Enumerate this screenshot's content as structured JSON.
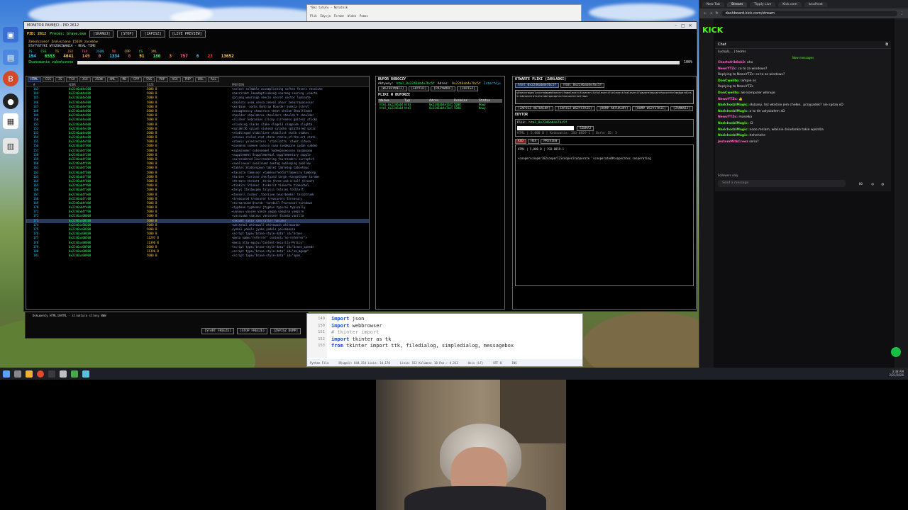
{
  "notepad": {
    "title": "*Bez tytułu - Notatnik",
    "menu": [
      "Plik",
      "Edycja",
      "Format",
      "Widok",
      "Pomoc"
    ]
  },
  "app": {
    "title": "MONITOR PAMIĘCI - PID 2612",
    "pid_label": "PID: 2612",
    "process_label": "Proces: brave.exe",
    "buttons": [
      "[SKANUJ]",
      "[STOP]",
      "[ZAPISZ]",
      "[LIVE PREVIEW]"
    ],
    "line_finished": "Zakończono! Znaleziono 15619 zasobów",
    "line_stats": "STATYSTYKI WYSZUKIWANIA - REAL-TIME",
    "stat_labels": [
      "JS",
      "CSS",
      "TS",
      "JSX",
      "TSX",
      "JSON",
      "MD",
      "CPP",
      "CS",
      "XML"
    ],
    "stat_values": [
      "194",
      "6553",
      "4041",
      "149",
      "0",
      "1334",
      "0",
      "91",
      "180",
      "3",
      "757",
      "6",
      "23",
      "13652"
    ],
    "scan_status": "Skanowanie zakończone",
    "progress_pct": "100%",
    "progress_value": 1.0,
    "grid_tabs": [
      "HTML",
      "CSS",
      "JS",
      "TSX",
      "JSX",
      "JSON",
      "XML",
      "MD",
      "CPP",
      "SVG",
      "PHP",
      "ASX",
      "PHP",
      "URL",
      "ALL"
    ],
    "grid_headers": [
      "#",
      "ADDR",
      "SIZE",
      "PREVIEW"
    ],
    "grid_rows": [
      [
        "143",
        "0x2246ab4e308",
        "5000 B",
        "<select seldable accomplishing soften fevers resolute"
      ],
      [
        "144",
        "0x2246ab4e408",
        "5000 B",
        "coacritakt lawadaptiveknog soarneg searing ,coacte"
      ],
      [
        "145",
        "0x2246ab4e508",
        "5000 B",
        "cprjong wearingo seecin secret sector luminate"
      ],
      [
        "146",
        "0x2246ab4e608",
        "5000 B",
        "<zealots usea sensa zeneal ansor zeearrapacessor"
      ],
      [
        "147",
        "0x2246ab4e708",
        "5000 B",
        "<xorbian -xorbs Rontrax Roarder zonkta schrot"
      ],
      [
        "148",
        "0x2246ab4e808",
        "5000 B",
        "schaughnessy shawcross sheat sholan Shoultleach"
      ],
      [
        "149",
        "0x2246ab4e908",
        "5000 B",
        "shoulder shoulderes shoulders shouldn't shoulder"
      ],
      [
        "150",
        "0x2246ab4ea08",
        "5000 B",
        "<slicker Sobranies slicky sirreness gaitess sticks"
      ],
      [
        "151",
        "0x2246ab4eb08",
        "5000 B",
        "<slacking slacks slake slagel3 slagelde slighte"
      ],
      [
        "152",
        "0x2246ab4ec08",
        "5000 B",
        "<splakl16 splash sixkes8 splashe splattered splic"
      ],
      [
        "153",
        "0x2246ab4ed08",
        "5000 B",
        "<stablinged stabilizer stabilist stalk stakes"
      ],
      [
        "154",
        "0x2246ab4ee08",
        "5000 B",
        "<stasun staled stat state static-of-the-art stati"
      ],
      [
        "155",
        "0x2246ab4ef08",
        "5000 B",
        "<stwels yuleszerters 'stzellotts 'stwer,sitwsa"
      ],
      [
        "156",
        "0x2246ab4f008",
        "5000 B",
        "<cueanno sueeee suesso suaa sueakpine sudan sudden"
      ],
      [
        "157",
        "0x2246ab4f108",
        "5000 B",
        "<subsonomer subsonemel Sudeepnoeessex suoaaoaaa"
      ],
      [
        "158",
        "0x2246ab4f208",
        "5000 B",
        "<supplement Ssupplemental supplementary supple"
      ],
      [
        "159",
        "0x2246ab4f308",
        "5000 B",
        "<surrendered Isurrendering fsurrenders surreptit"
      ],
      [
        "160",
        "0x2246ab4f408",
        "5000 B",
        "<swallouua? swalloued swetag swaloqing swallow"
      ],
      [
        "161",
        "0x2246ab4f508",
        "5000 B",
        "<tables Stablespoon tablet tabletop tabletops"
      ],
      [
        "162",
        "0x2246ab4f608",
        "5000 B",
        "<tacoste tamesnor +tamenorfeotor!Tamencry tamblep"
      ],
      [
        "163",
        "0x2246ab4f708",
        "5000 B",
        "<tarine -tarinse cherlyaid targe +targethame tarame"
      ],
      [
        "164",
        "0x2246ab4f808",
        "5000 B",
        "<threats threatt ,three three-and-a-half threatt"
      ],
      [
        "165",
        "0x2246ab4f908",
        "5000 B",
        "<tinkits Stinker ,tinkerit tinkorte tinkorbel"
      ],
      [
        "166",
        "0x2246ab4fa08",
        "5000 B",
        "<tolyl Itolbyspeo tolylsi tolnies tolblert"
      ],
      [
        "167",
        "0x2246ab4fb08",
        "5000 B",
        "<toesnll tucker ,tocsiiee toucrbookir tosibtrunk"
      ],
      [
        "168",
        "0x2246ab4fc08",
        "5000 B",
        "<treasured treasurer treasurers Streasury"
      ],
      [
        "169",
        "0x2246ab4fd08",
        "5000 B",
        "<turnaround Qturnb 'turnbull Fturncoat turndown"
      ],
      [
        "170",
        "0x2246ab4fe08",
        "5000 B",
        "<typhoon typhoons jtyphus typical typically"
      ],
      [
        "171",
        "0x2246ab4ff08",
        "5000 B",
        "<uuuuuu vaucee vance vagaa vangina vampire"
      ],
      [
        "172",
        "0x2246ac00008",
        "5000 B",
        "<vascuuma vaacous vancouver Evanda vanilla"
      ],
      [
        "173",
        "0x2246ac00108",
        "5000 B",
        "<neaumt sanie sancratier hacuker",
        "sel"
      ],
      [
        "174",
        "0x2246ac00208",
        "5000 B",
        "<whitewal whitewall whitewash whitewater"
      ],
      [
        "175",
        "0x2246ac00308",
        "5000 B",
        "<yokel yokels jyoke yodels yolooaassa"
      ],
      [
        "176",
        "0x2246ac00408",
        "5000 B",
        "<script type=\"brave-style-data\" id=\"brave"
      ],
      [
        "177",
        "0x2246ac00508",
        "11297 B",
        "<meta name=\"referrer\" content=\"no-referrer\">"
      ],
      [
        "178",
        "0x2246ac00608",
        "11396 B",
        "<meta http-equiv=\"Content-Security-Policy\""
      ],
      [
        "179",
        "0x2246ac00708",
        "5000 B",
        "<script type=\"brave-style-data\" id=\"brave_speedr"
      ],
      [
        "180",
        "0x2246ac00808",
        "11396 B",
        "<script type=\"brave-style-data\" id=\"aa_mgsqm\""
      ],
      [
        "181",
        "0x2246ac00908",
        "5000 B",
        "<script type=\"brave-style-data\" id=\"open_"
      ]
    ],
    "buffer": {
      "title": "BUFOR ROBOCZY",
      "active_label": "Aktywny:",
      "active_value": "html_0x2246ab4e7bc5f",
      "addr_label": "Adres:",
      "addr_value": "0x2246ab4e7bc5f",
      "mode": "Interfejs",
      "buttons": [
        "[WSTRZYKNIJ]",
        "[EDYTUJ]",
        "[PRZYWRÓĆ]",
        "[ZAPISZ]"
      ],
      "files_title": "PLIKI W BUFORZE",
      "headers": [
        "Nazwa",
        "Typ",
        "Adres",
        "Rozmiar",
        "Status"
      ],
      "rows": [
        [
          "html_0x2246ab4e7bc5f",
          "html",
          "0x2246ab4e7bc5f",
          "5000",
          "Nowy"
        ],
        [
          "html_0x2246ab4e7bc5f",
          "html",
          "0x2246ab4e7bc5f",
          "5000",
          "Nowy"
        ]
      ]
    },
    "editor": {
      "title": "OTWARTE PLIKI (ZAKŁADKI)",
      "tabs": [
        "html_0x2246ab4e7bc5f",
        "html_0x2246ab4e7bc5f"
      ],
      "hex_text": "s0severageslovoredageh0severifaaaleverifyseverifyfoleverifieleverifyeleverifyawarehaswarehouserhelmmbwardlestrideseveralsetstablepeopleclearwaterhollaws",
      "actions": [
        "[ZAPISZ AKTUALNY]",
        "[ZAPISZ WSZYSTKIE]",
        "[DUMP AKTUALNY]",
        "[DUMP WSZYSTKIE]",
        "[ZAMKNIJ]"
      ],
      "editor_title": "EDYTOR",
      "file_label": "Plik:",
      "file_value": "html_0x2246ab4e7bc5f",
      "search_btn": "SZUKAJ",
      "info_line": "HTML | 5,000 B | Kodowanie: ISO-8859-1 | Bufor ID: 3",
      "view_tabs": [
        "KOD",
        "HEX",
        "PREVIEW"
      ],
      "code_line1": "HTML | 5,000 B | ISO-8859-1",
      "code_line2": "<cooperscooper182cooper123cooper2cooperate 'scooperated#cooperates cooperating"
    },
    "bottom": {
      "status_text": "Dokumenty HTML/XHTML - struktura strony WWW",
      "buttons": [
        "[START FREEZE]",
        "[STOP FREEZE]",
        "[ZAPISZ DUMP]"
      ]
    }
  },
  "code_editor": {
    "line_numbers": [
      "149",
      "150",
      "151",
      "152",
      "153"
    ],
    "lines": [
      {
        "kw": "import",
        "rest": " json"
      },
      {
        "kw": "import",
        "rest": " webbrowser"
      },
      {
        "kw": "",
        "rest": "# tkinter import",
        "comment": true
      },
      {
        "kw": "import",
        "rest": " tkinter as tk"
      },
      {
        "kw": "from",
        "rest": " tkinter import ttk, filedialog, simpledialog, messagebox"
      }
    ],
    "status": [
      "Python File",
      "Długość: 844,154  Linie: 14,178",
      "Linia: 152  Kolumna: 18  Poz.: 4,313",
      "Unix (LF)",
      "UTF-8",
      "INS"
    ]
  },
  "taskbar": {
    "time": "3:38 AM",
    "date": "2/21/2026"
  },
  "browser": {
    "tabs": [
      "New Tab",
      "Stream",
      "Tipply Live",
      "Kick.com",
      "localhost"
    ],
    "url": "dashboard.kick.com/stream",
    "logo": "KICK",
    "chat": {
      "title": "Chat",
      "pinned": "Lucky\\L... | teoms",
      "new_messages": "New messages",
      "lines": [
        {
          "user": "Chartafrik0ok3",
          "text": ": oho",
          "style": "u2"
        },
        {
          "user": "NewrYTZc",
          "text": ": co to za windows?",
          "style": "u2"
        },
        {
          "user": "",
          "text": "Replying to NewvYTZc: co to za windows?",
          "style": ""
        },
        {
          "user": "DonCwelito:",
          "text": " lampie os",
          "style": "u"
        },
        {
          "user": "",
          "text": "Replying to NewvYTZc",
          "style": ""
        },
        {
          "user": "DonCwelito:",
          "text": " ale komputer wlknuje",
          "style": "u"
        },
        {
          "user": "NewvYTZc:",
          "text": " 👍",
          "style": "u2"
        },
        {
          "user": "NadchodziMagic:",
          "text": " słubany, też właśnie jem chełke.. przypadek? nie sądzę xD",
          "style": "u"
        },
        {
          "user": "NadchodziMagic:",
          "text": " a to tle usłyszałem xD",
          "style": "u"
        },
        {
          "user": "NewvYTZc:",
          "text": " masełko",
          "style": "u2"
        },
        {
          "user": "NadchodziMagic:",
          "text": " :D",
          "style": "u"
        },
        {
          "user": "NadchodziMagic:",
          "text": " nooo mniam, właśnie śniadanko takie wjeżdża",
          "style": "u"
        },
        {
          "user": "NadchodziMagic:",
          "text": " hehehehe",
          "style": "u"
        },
        {
          "user": "JestemMitkCreez",
          "text": " serio?",
          "style": "u2"
        }
      ],
      "followers_only": "Followers only",
      "input_placeholder": "Send a message",
      "viewer_count": "00"
    }
  }
}
